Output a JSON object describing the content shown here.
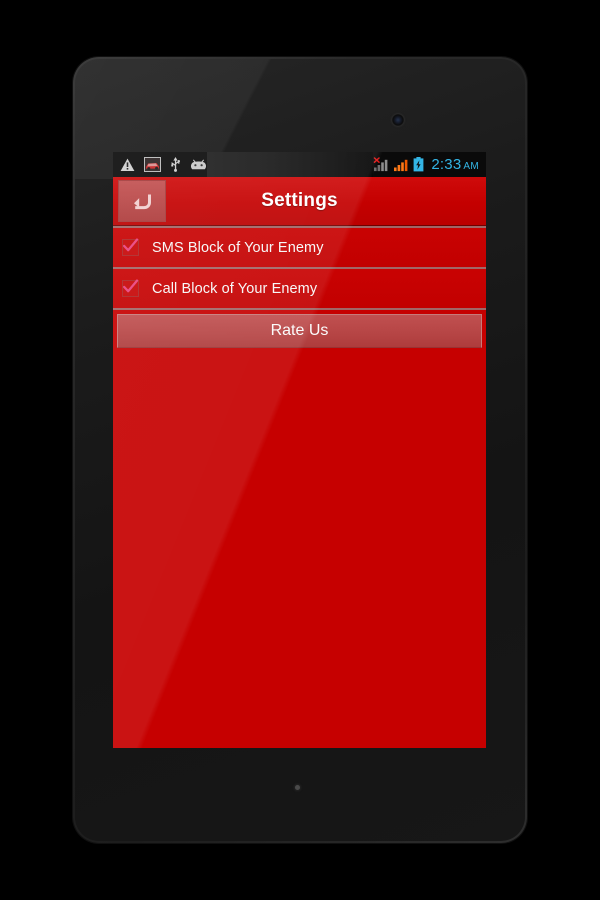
{
  "device": {
    "name": "android-tablet",
    "bezel_color": "#232323"
  },
  "statusbar": {
    "left_icons": [
      {
        "name": "warning-triangle-icon",
        "glyph": "warning"
      },
      {
        "name": "car-photo-icon",
        "glyph": "car-thumbnail"
      },
      {
        "name": "usb-icon",
        "glyph": "usb"
      },
      {
        "name": "android-robot-icon",
        "glyph": "android-head"
      }
    ],
    "right_icons": [
      {
        "name": "signal-no-service-icon",
        "glyph": "signal-bars-x"
      },
      {
        "name": "signal-strength-icon",
        "glyph": "signal-bars"
      },
      {
        "name": "battery-charging-icon",
        "glyph": "battery-bolt"
      }
    ],
    "clock_time": "2:33",
    "clock_ampm": "AM",
    "clock_color": "#33b5e5"
  },
  "appbar": {
    "back_label": "Back",
    "title": "Settings",
    "accent_color": "#c40000"
  },
  "settings": {
    "rows": [
      {
        "label": "SMS Block of Your Enemy",
        "checked": true
      },
      {
        "label": "Call Block of Your Enemy",
        "checked": true
      }
    ]
  },
  "actions": {
    "rate_label": "Rate Us"
  }
}
